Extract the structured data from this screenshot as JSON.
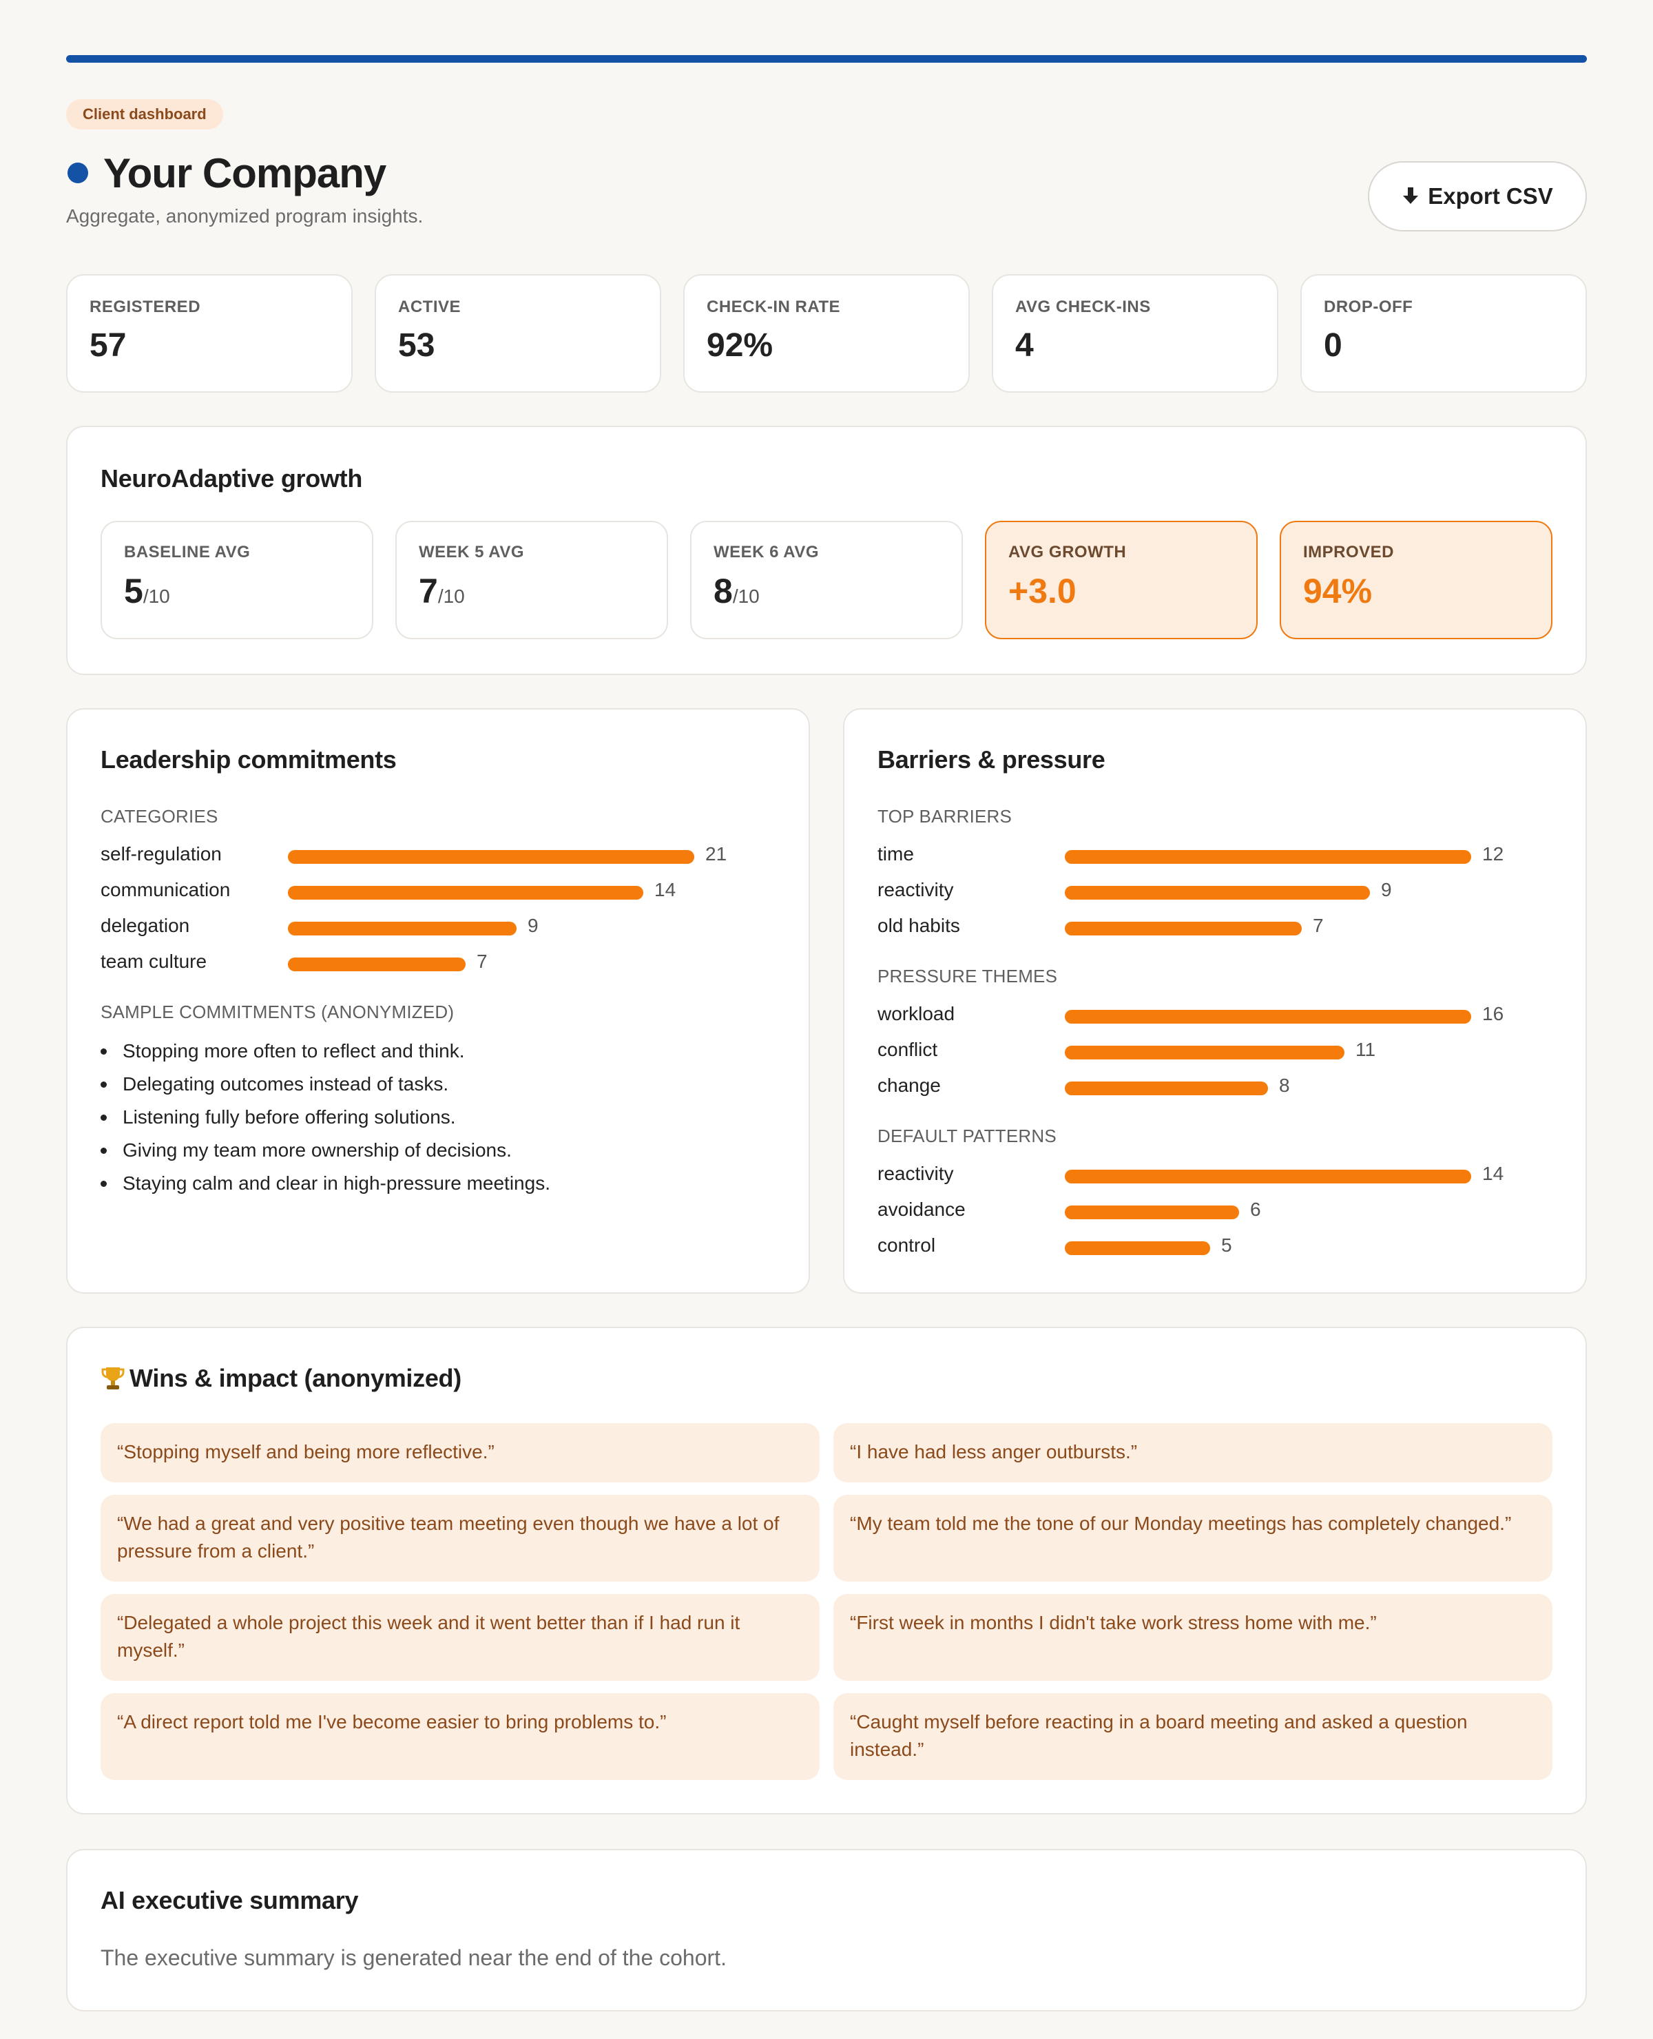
{
  "header": {
    "tag": "Client dashboard",
    "title": "Your Company",
    "subtitle": "Aggregate, anonymized program insights.",
    "export_icon": "download-icon",
    "export_label": "Export CSV",
    "accent_color": "#1452a6"
  },
  "stats": [
    {
      "label": "REGISTERED",
      "value": "57"
    },
    {
      "label": "ACTIVE",
      "value": "53"
    },
    {
      "label": "CHECK-IN RATE",
      "value": "92%"
    },
    {
      "label": "AVG CHECK-INS",
      "value": "4"
    },
    {
      "label": "DROP-OFF",
      "value": "0"
    }
  ],
  "growth": {
    "title": "NeuroAdaptive growth",
    "metrics": [
      {
        "label": "BASELINE AVG",
        "value": "5",
        "unit": "/10"
      },
      {
        "label": "WEEK 5 AVG",
        "value": "7",
        "unit": "/10"
      },
      {
        "label": "WEEK 6 AVG",
        "value": "8",
        "unit": "/10"
      },
      {
        "label": "AVG GROWTH",
        "value": "+3.0",
        "unit": ""
      },
      {
        "label": "IMPROVED",
        "value": "94%",
        "unit": ""
      }
    ],
    "highlight_color": "#f07a12"
  },
  "leadership": {
    "title": "Leadership commitments",
    "categories_label": "CATEGORIES",
    "categories": [
      {
        "name": "self-regulation",
        "value": 21
      },
      {
        "name": "communication",
        "value": 14
      },
      {
        "name": "delegation",
        "value": 9
      },
      {
        "name": "team culture",
        "value": 7
      }
    ],
    "samples_label": "SAMPLE COMMITMENTS (ANONYMIZED)",
    "samples": [
      "Stopping more often to reflect and think.",
      "Delegating outcomes instead of tasks.",
      "Listening fully before offering solutions.",
      "Giving my team more ownership of decisions.",
      "Staying calm and clear in high-pressure meetings."
    ]
  },
  "barriers": {
    "title": "Barriers & pressure",
    "groups": [
      {
        "label": "TOP BARRIERS",
        "items": [
          {
            "name": "time",
            "value": 12
          },
          {
            "name": "reactivity",
            "value": 9
          },
          {
            "name": "old habits",
            "value": 7
          }
        ]
      },
      {
        "label": "PRESSURE THEMES",
        "items": [
          {
            "name": "workload",
            "value": 16
          },
          {
            "name": "conflict",
            "value": 11
          },
          {
            "name": "change",
            "value": 8
          }
        ]
      },
      {
        "label": "DEFAULT PATTERNS",
        "items": [
          {
            "name": "reactivity",
            "value": 14
          },
          {
            "name": "avoidance",
            "value": 6
          },
          {
            "name": "control",
            "value": 5
          }
        ]
      }
    ],
    "bar_color": "#f57c0a"
  },
  "wins": {
    "icon": "trophy-icon",
    "title": "Wins & impact (anonymized)",
    "quotes": [
      "“Stopping myself and being more reflective.”",
      "“I have had less anger outbursts.”",
      "“We had a great and very positive team meeting even though we have a lot of pressure from a client.”",
      "“My team told me the tone of our Monday meetings has completely changed.”",
      "“Delegated a whole project this week and it went better than if I had run it myself.”",
      "“First week in months I didn't take work stress home with me.”",
      "“A direct report told me I've become easier to bring problems to.”",
      "“Caught myself before reacting in a board meeting and asked a question instead.”"
    ]
  },
  "summary": {
    "title": "AI executive summary",
    "text": "The executive summary is generated near the end of the cohort."
  }
}
